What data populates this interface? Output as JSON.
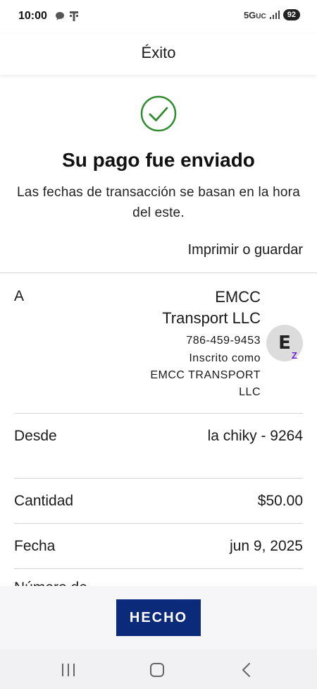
{
  "status_bar": {
    "time": "10:00",
    "network": "5G",
    "network_sub": "UC",
    "battery": "92"
  },
  "header": {
    "title": "Éxito"
  },
  "confirmation": {
    "headline": "Su pago fue enviado",
    "subtext": "Las fechas de transacción se basan en la hora del este.",
    "print_label": "Imprimir o guardar"
  },
  "recipient": {
    "label": "A",
    "name_line1": "EMCC",
    "name_line2": "Transport LLC",
    "phone": "786-459-9453",
    "enrolled_line1": "Inscrito como",
    "enrolled_line2": "EMCC TRANSPORT",
    "enrolled_line3": "LLC",
    "avatar_letter": "E",
    "badge": "Z"
  },
  "details": {
    "from_label": "Desde",
    "from_value": "la chiky - 9264",
    "amount_label": "Cantidad",
    "amount_value": "$50.00",
    "date_label": "Fecha",
    "date_value": "jun 9, 2025",
    "next_label_partial": "Número de"
  },
  "footer": {
    "done_label": "HECHO"
  },
  "colors": {
    "success": "#2e8b2e",
    "primary_button": "#0b2a7a",
    "zelle": "#6d1ed4"
  },
  "icons": [
    "chat-bubble-icon",
    "tmobile-icon",
    "signal-icon",
    "check-circle-icon",
    "recents-icon",
    "home-icon",
    "back-icon"
  ]
}
